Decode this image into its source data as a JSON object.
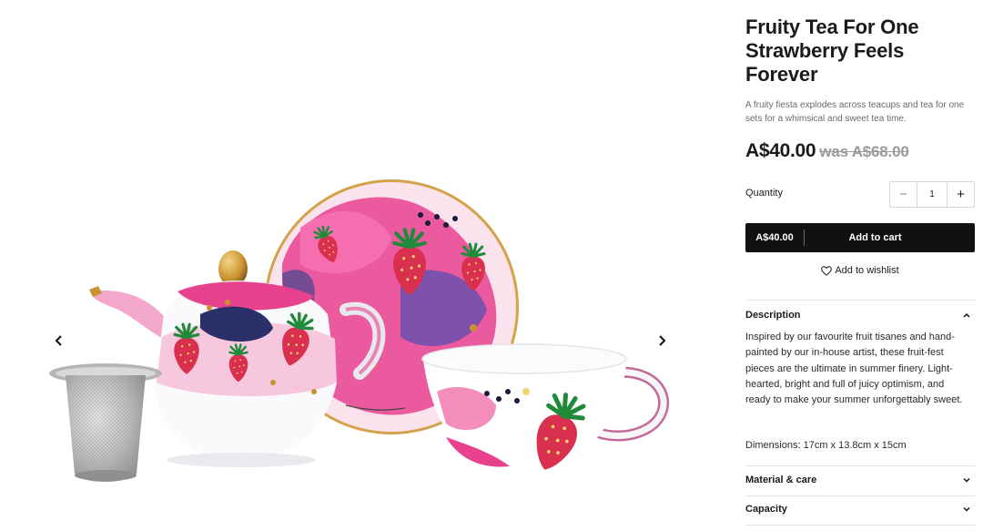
{
  "product": {
    "title": "Fruity Tea For One Strawberry Feels Forever",
    "subtitle": "A fruity fiesta explodes across teacups and tea for one sets for a whimsical and sweet tea time.",
    "price": "A$40.00",
    "was_price": "was A$68.00"
  },
  "quantity": {
    "label": "Quantity",
    "value": "1",
    "minus": "−",
    "plus": "+"
  },
  "cart": {
    "price": "A$40.00",
    "label": "Add to cart"
  },
  "wishlist": {
    "label": "Add to wishlist",
    "icon": "heart-icon"
  },
  "accordion": {
    "description": {
      "title": "Description",
      "body": "Inspired by our favourite fruit tisanes and hand-painted by our in-house artist, these fruit-fest pieces are the ultimate in summer finery. Light-hearted, bright and full of juicy optimism, and ready to make your summer unforgettably sweet.",
      "dimensions": "Dimensions: 17cm x 13.8cm x 15cm",
      "state": "expanded"
    },
    "material": {
      "title": "Material & care",
      "state": "collapsed"
    },
    "capacity": {
      "title": "Capacity",
      "state": "collapsed"
    }
  },
  "gallery": {
    "prev_icon": "chevron-left-icon",
    "next_icon": "chevron-right-icon"
  },
  "colors": {
    "primary_button": "#111111",
    "accent_pink": "#e23a8a",
    "strawberry": "#d9304f",
    "leaf_green": "#1f8a3a",
    "gold": "#c8932f"
  }
}
